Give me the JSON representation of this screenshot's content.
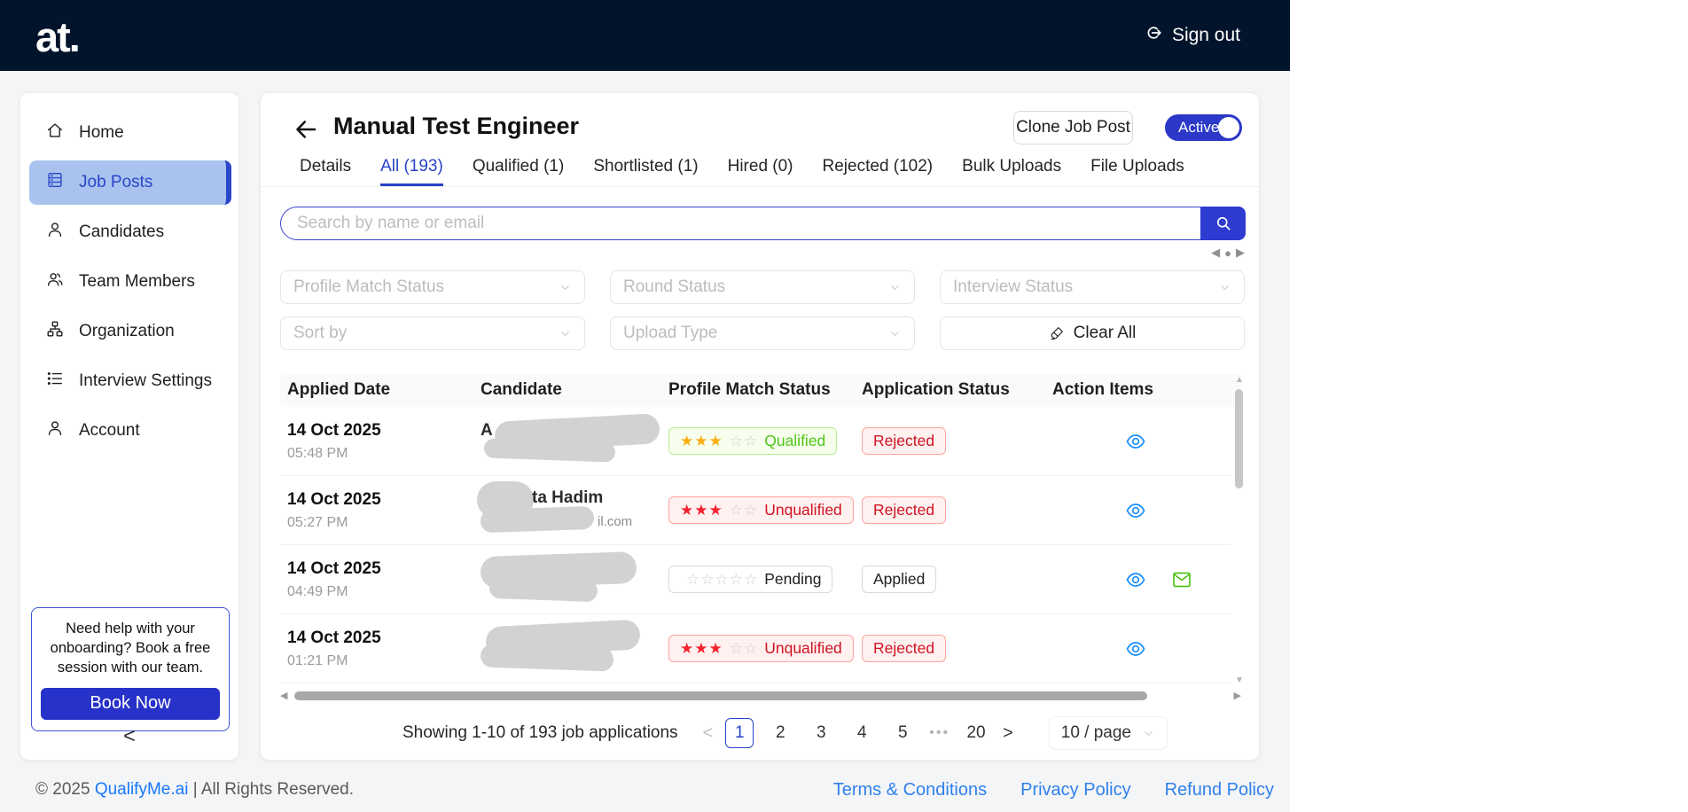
{
  "colors": {
    "topbar_bg": "#02142b",
    "primary_blue": "#2b38c8",
    "tab_active_blue": "#2643c8",
    "sidebar_active_bg": "#a9c3ee",
    "link_blue": "#2f80ed",
    "qualified_green": "#52c41a",
    "qualified_bg": "#f6ffed",
    "rejected_red": "#cf1322",
    "rejected_bg": "#fff1f0",
    "star_gold": "#faad14",
    "star_red": "#f5222d",
    "eye_icon_blue": "#1890ff",
    "mail_icon_green": "#52c41a"
  },
  "topbar": {
    "logo": "at.",
    "signout": "Sign out"
  },
  "sidebar": {
    "items": [
      {
        "label": "Home"
      },
      {
        "label": "Job Posts"
      },
      {
        "label": "Candidates"
      },
      {
        "label": "Team Members"
      },
      {
        "label": "Organization"
      },
      {
        "label": "Interview Settings"
      },
      {
        "label": "Account"
      }
    ],
    "help_text": "Need help with your onboarding? Book a free session with our team.",
    "book_now": "Book Now",
    "collapse": "<"
  },
  "header": {
    "title": "Manual Test Engineer",
    "clone_button": "Clone Job Post",
    "status_toggle": "Active"
  },
  "tabs": [
    {
      "label": "Details"
    },
    {
      "label": "All (193)"
    },
    {
      "label": "Qualified (1)"
    },
    {
      "label": "Shortlisted (1)"
    },
    {
      "label": "Hired (0)"
    },
    {
      "label": "Rejected (102)"
    },
    {
      "label": "Bulk Uploads"
    },
    {
      "label": "File Uploads"
    }
  ],
  "search": {
    "placeholder": "Search by name or email"
  },
  "filters": {
    "profile_match": "Profile Match Status",
    "round_status": "Round Status",
    "interview_status": "Interview Status",
    "sort_by": "Sort by",
    "upload_type": "Upload Type",
    "clear_all": "Clear All"
  },
  "table": {
    "columns": [
      "Applied Date",
      "Candidate",
      "Profile Match Status",
      "Application Status",
      "Action Items"
    ],
    "rows": [
      {
        "date": "14 Oct 2025",
        "time": "05:48 PM",
        "name_fragment": "A",
        "email_fragment": "",
        "stars_filled": "★★★",
        "stars_empty": "☆☆",
        "match_label": "Qualified",
        "status": "Rejected"
      },
      {
        "date": "14 Oct 2025",
        "time": "05:27 PM",
        "name_fragment": "ta Hadim",
        "email_fragment": "il.com",
        "stars_filled": "★★★",
        "stars_empty": "☆☆",
        "match_label": "Unqualified",
        "status": "Rejected"
      },
      {
        "date": "14 Oct 2025",
        "time": "04:49 PM",
        "name_fragment": "",
        "email_fragment": "",
        "stars_filled": "",
        "stars_empty": "☆☆☆☆☆",
        "match_label": "Pending",
        "status": "Applied"
      },
      {
        "date": "14 Oct 2025",
        "time": "01:21 PM",
        "name_fragment": "",
        "email_fragment": "",
        "stars_filled": "★★★",
        "stars_empty": "☆☆",
        "match_label": "Unqualified",
        "status": "Rejected"
      }
    ]
  },
  "pagination": {
    "summary": "Showing 1-10 of 193 job applications",
    "prev": "<",
    "pages": [
      "1",
      "2",
      "3",
      "4",
      "5"
    ],
    "ellipsis": "•••",
    "last_page": "20",
    "next": ">",
    "page_size": "10 / page"
  },
  "footer": {
    "copyright_prefix": "© 2025 ",
    "brand": "QualifyMe.ai",
    "copyright_suffix": " | All Rights Reserved.",
    "links": [
      {
        "label": "Terms & Conditions"
      },
      {
        "label": "Privacy Policy"
      },
      {
        "label": "Refund Policy"
      }
    ]
  }
}
